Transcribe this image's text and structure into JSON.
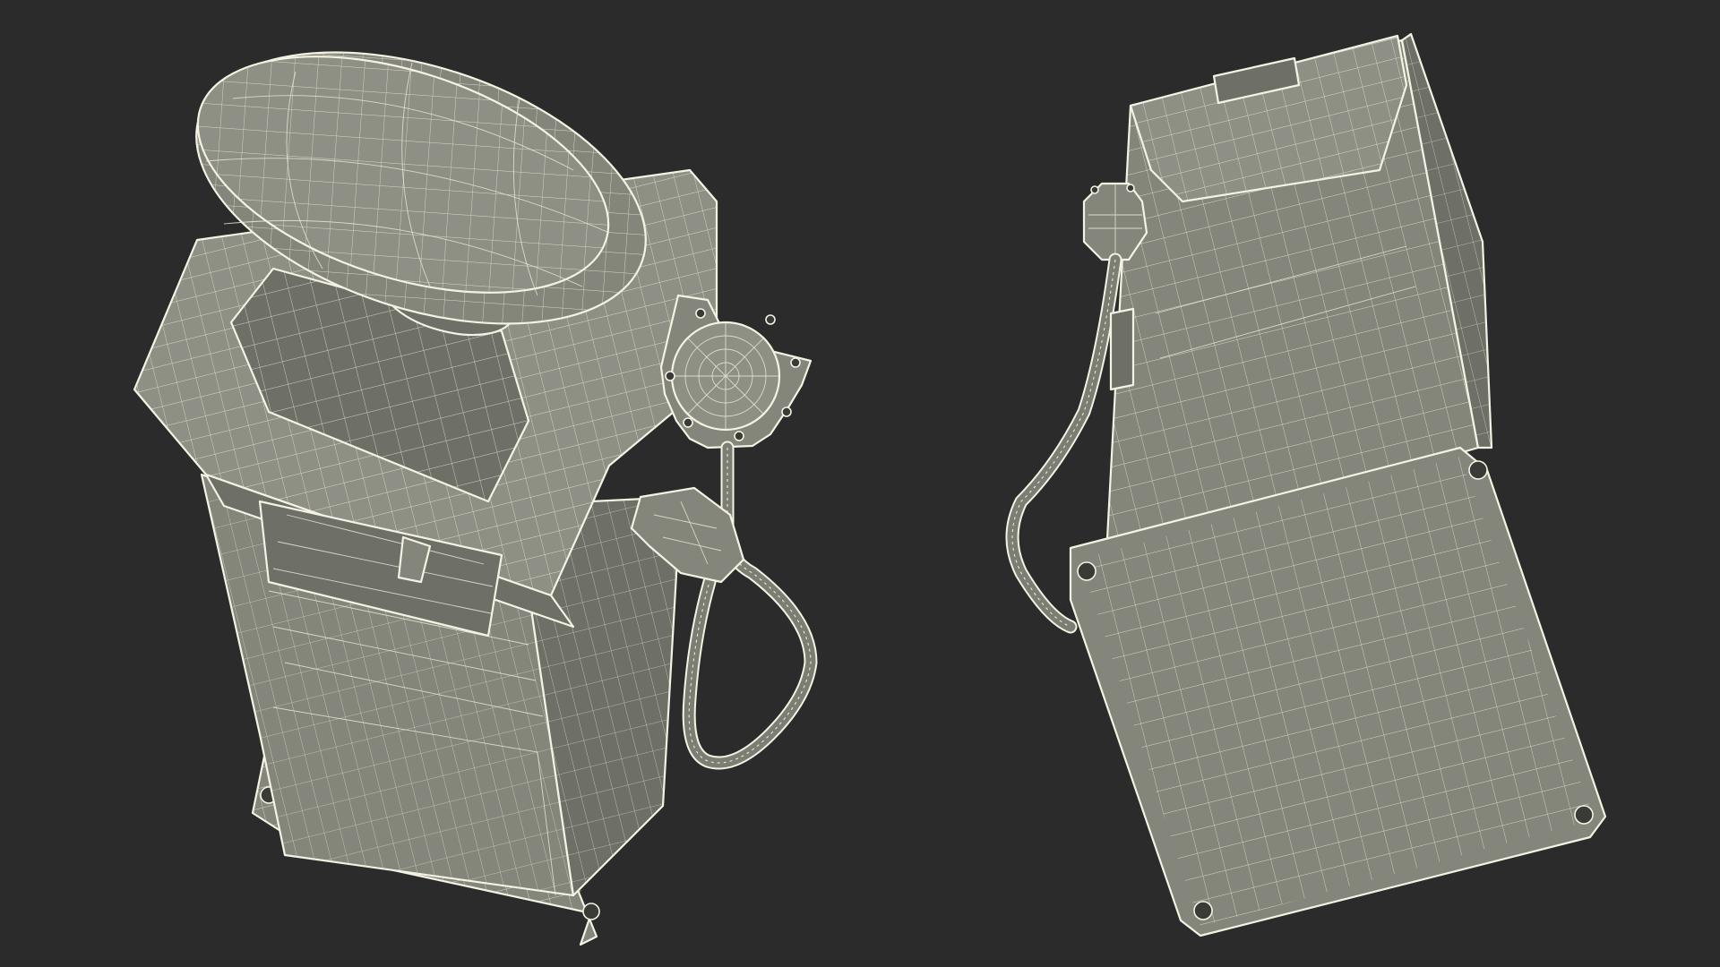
{
  "scene": {
    "background": "#2b2b2b",
    "wire_color": "#f4f2e2",
    "surface_color": "#84867b",
    "subjects": [
      {
        "name": "fuel-pump-top-view",
        "icon": "fuel-pump-icon"
      },
      {
        "name": "fuel-pump-bottom-view",
        "icon": "fuel-pump-icon"
      }
    ]
  }
}
